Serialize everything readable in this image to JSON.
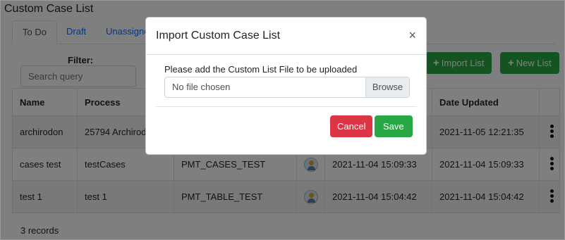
{
  "page": {
    "title": "Custom Case List",
    "records_text": "3 records"
  },
  "tabs": [
    {
      "label": "To Do",
      "active": true
    },
    {
      "label": "Draft",
      "active": false
    },
    {
      "label": "Unassigned",
      "active": false
    }
  ],
  "filter": {
    "label": "Filter:",
    "placeholder": "Search query"
  },
  "toolbar": {
    "import_label": "Import List",
    "new_label": "New List",
    "plus_icon": "+"
  },
  "table": {
    "headers": {
      "name": "Name",
      "process": "Process",
      "table": "",
      "user": "",
      "date_created": "",
      "date_updated": "Date Updated",
      "actions": ""
    },
    "rows": [
      {
        "name": "archirodon",
        "process": "25794 Archirodon",
        "table": "",
        "date_created": "",
        "date_updated": "2021-11-05 12:21:35"
      },
      {
        "name": "cases test",
        "process": "testCases",
        "table": "PMT_CASES_TEST",
        "date_created": "2021-11-04 15:09:33",
        "date_updated": "2021-11-04 15:09:33"
      },
      {
        "name": "test 1",
        "process": "test 1",
        "table": "PMT_TABLE_TEST",
        "date_created": "2021-11-04 15:04:42",
        "date_updated": "2021-11-04 15:04:42"
      }
    ]
  },
  "modal": {
    "title": "Import Custom Case List",
    "close_icon": "×",
    "message": "Please add the Custom List File to be uploaded",
    "file_value": "No file chosen",
    "browse_label": "Browse",
    "cancel_label": "Cancel",
    "save_label": "Save"
  },
  "colors": {
    "primary": "#0d6efd",
    "success": "#28a745",
    "danger": "#dc3545",
    "backdrop": "rgba(0,0,0,0.5)"
  }
}
